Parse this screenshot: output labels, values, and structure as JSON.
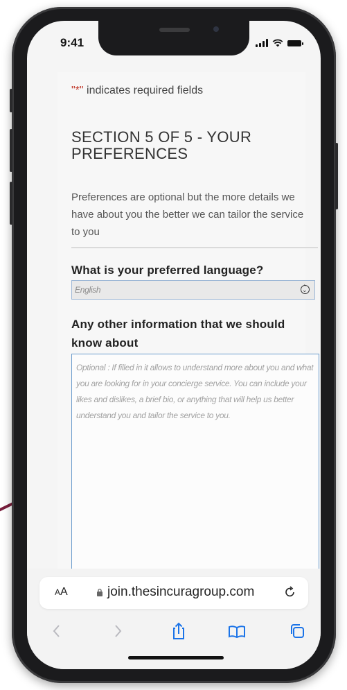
{
  "status_bar": {
    "time": "9:41"
  },
  "form": {
    "required_marker": "\"*\"",
    "required_text": " indicates required fields",
    "section_title": "SECTION 5 OF 5 - YOUR PREFERENCES",
    "intro": "Preferences are optional but the more details we have about you the better we can tailor the service to you",
    "language_label": "What is your preferred language?",
    "language_value": "English",
    "other_info_label": "Any other information that we should know about",
    "other_info_placeholder": "Optional : If filled in it allows to understand more about you and what you are looking for in your concierge service. You can include your likes and dislikes, a brief bio, or anything that will help us better understand you and tailor the service to you."
  },
  "browser": {
    "text_size_label_small": "A",
    "text_size_label_large": "A",
    "url": "join.thesincuragroup.com",
    "icons": [
      "back-icon",
      "forward-icon",
      "share-icon",
      "bookmarks-icon",
      "tabs-icon",
      "reload-icon",
      "lock-icon"
    ]
  },
  "colors": {
    "accent": "#7a1f3d",
    "ios_blue": "#1a73e8",
    "required_star": "#c0392b",
    "field_border": "#6a9ccc"
  }
}
